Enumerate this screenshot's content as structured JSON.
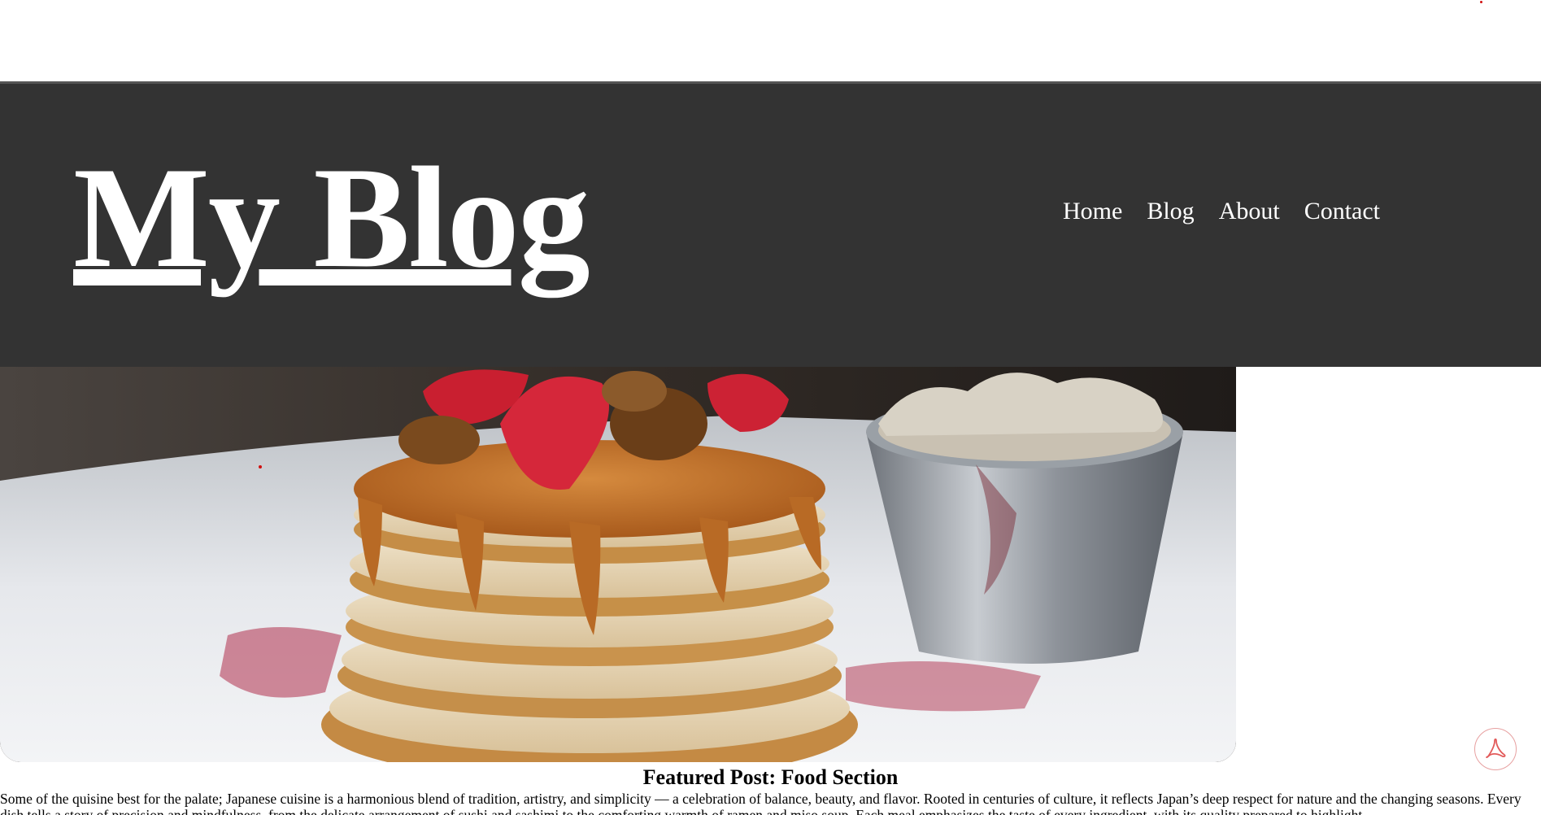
{
  "header": {
    "site_title": "My Blog",
    "nav": [
      "Home",
      "Blog",
      "About",
      "Contact"
    ]
  },
  "hero": {
    "image_icon": "pancake-stack-photo"
  },
  "post": {
    "title": "Featured Post: Food Section",
    "body": "Some of the quisine best for the palate; Japanese cuisine is a harmonious blend of tradition, artistry, and simplicity — a celebration of balance, beauty, and flavor. Rooted in centuries of culture, it reflects Japan’s deep respect for nature and the changing seasons. Every dish tells a story of precision and mindfulness, from the delicate arrangement of sushi and sashimi to the comforting warmth of ramen and miso soup. Each meal emphasizes the taste of every ingredient, with its quality prepared to highlight"
  },
  "floating": {
    "pdf_icon": "pdf-icon"
  },
  "colors": {
    "header_bg": "#333333",
    "nav_text": "#ffffff",
    "page_bg": "#ffffff"
  }
}
